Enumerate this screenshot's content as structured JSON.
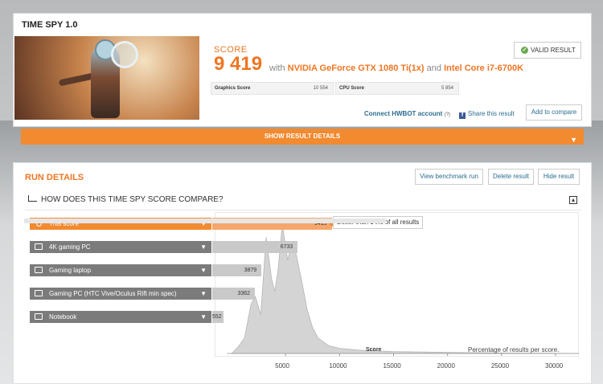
{
  "colors": {
    "accent": "#ee7623",
    "bar_orange": "#f28a2f",
    "bar_gray": "#a7a7a7",
    "link": "#2b6d8e",
    "valid": "#6aa84f"
  },
  "result": {
    "title": "TIME SPY 1.0",
    "score_label": "SCORE",
    "score_value": "9 419",
    "with_text": "with",
    "gpu": "NVIDIA GeForce GTX 1080 Ti(1x)",
    "and_text": "and",
    "cpu": "Intel Core i7-6700K",
    "graphics_label": "Graphics Score",
    "graphics_value": "10 554",
    "cpu_label": "CPU Score",
    "cpu_value": "5 854",
    "valid_label": "VALID RESULT",
    "valid_icon": "check-circle-icon",
    "hwbot_label": "Connect HWBOT account",
    "hwbot_help": "(?)",
    "share_label": "Share this result",
    "share_icon": "facebook-icon",
    "compare_label": "Add to compare",
    "show_details": "SHOW RESULT DETAILS"
  },
  "run": {
    "title": "RUN DETAILS",
    "buttons": [
      "View benchmark run",
      "Delete result",
      "Hide result"
    ],
    "compare_title": "HOW DOES THIS TIME SPY SCORE COMPARE?",
    "better_pre": "Better than",
    "better_pct": "94%",
    "better_post": "of all results",
    "rows": [
      {
        "label": "This score",
        "value": 9419,
        "icon": "trophy-icon",
        "highlight": true
      },
      {
        "label": "4K gaming PC",
        "value": 6733,
        "icon": "monitor-icon",
        "highlight": false
      },
      {
        "label": "Gaming laptop",
        "value": 3879,
        "icon": "laptop-icon",
        "highlight": false
      },
      {
        "label": "Gaming PC (HTC Vive/Oculus Rift min spec)",
        "value": 3362,
        "icon": "laptop-icon",
        "highlight": false
      },
      {
        "label": "Notebook",
        "value": 552,
        "icon": "laptop-icon",
        "highlight": false
      }
    ]
  },
  "chart_data": {
    "type": "area",
    "xlabel": "Score",
    "ylabel": "Percentage of results per score.",
    "x_ticks": [
      5000,
      10000,
      15000,
      20000,
      25000,
      30000
    ],
    "xlim": [
      0,
      32000
    ],
    "distribution": {
      "x": [
        0,
        600,
        1200,
        1800,
        2200,
        2700,
        3200,
        3700,
        4000,
        4300,
        4700,
        5200,
        5600,
        6000,
        6500,
        7000,
        7500,
        8000,
        9000,
        10000,
        12000,
        15000,
        20000,
        25000,
        30000,
        32000
      ],
      "y": [
        0,
        5,
        12,
        38,
        44,
        30,
        90,
        58,
        48,
        64,
        100,
        72,
        86,
        76,
        56,
        34,
        20,
        12,
        6,
        4,
        2.5,
        1.5,
        0.8,
        0.4,
        0.1,
        0
      ]
    }
  }
}
